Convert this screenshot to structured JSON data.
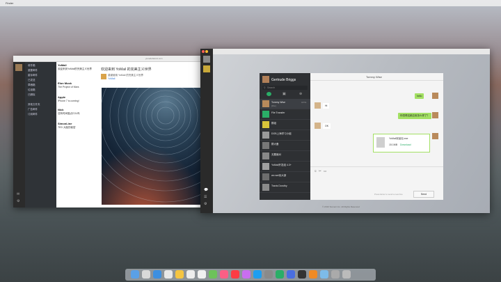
{
  "menubar": {
    "app": "Finder"
  },
  "mail": {
    "window_title": "yunedebarcul.com",
    "folders": [
      "收件箱",
      "重要邮件",
      "星标邮件",
      "已发送",
      "草稿箱",
      "垃圾箱",
      "已删除",
      "其他文件夹",
      "广告邮件",
      "订阅邮件"
    ],
    "items": [
      {
        "from": "YoMail",
        "subject": "欢迎来到YoMail的完美主义世界",
        "time": ""
      },
      {
        "from": "Elon Musk",
        "subject": "The Project of Mars",
        "time": ""
      },
      {
        "from": "Apple",
        "subject": "iPhone 7 is coming!",
        "time": ""
      },
      {
        "from": "Nick",
        "subject": "还有时间做点什么吗",
        "time": ""
      },
      {
        "from": "SimonLine",
        "subject": "TED 大脑的秘密",
        "time": ""
      }
    ],
    "reading": {
      "subject": "欢迎来到 YoMail 的完美主义世界",
      "from": "YoMail",
      "body": "感谢使用 YoMail 的完美主义世界"
    }
  },
  "chat": {
    "profile_name": "Gertrude Briggs",
    "search_placeholder": "Search",
    "contacts": [
      {
        "name": "Tommy Wise",
        "sub": "[File]",
        "time": "18:51"
      },
      {
        "name": "File Transfer",
        "sub": "",
        "time": ""
      },
      {
        "name": "群组",
        "sub": "",
        "time": ""
      },
      {
        "name": "DOB上海学习小组",
        "sub": "",
        "time": ""
      },
      {
        "name": "群大备",
        "sub": "",
        "time": ""
      },
      {
        "name": "无题面对",
        "sub": "",
        "time": ""
      },
      {
        "name": "YoMail开发组 4.3+",
        "sub": "",
        "time": ""
      },
      {
        "name": "wo.wei优大部",
        "sub": "",
        "time": ""
      },
      {
        "name": "Travis Dorothy",
        "sub": "",
        "time": ""
      }
    ],
    "header_name": "Tommy Wise",
    "messages": [
      {
        "side": "right",
        "text": "hello"
      },
      {
        "side": "left",
        "text": "Hi"
      },
      {
        "side": "right",
        "text": "你觉得这款应用怎么样了？"
      },
      {
        "side": "left",
        "text": "OK"
      }
    ],
    "file_msg": {
      "name": "YoMail安装包.exe",
      "size": "15.1MB",
      "action": "Download"
    },
    "input_hint": "Press Enter to send a new line",
    "send_label": "Send",
    "footer": "© 2016 Tencent Inc. All Rights Reserved"
  }
}
